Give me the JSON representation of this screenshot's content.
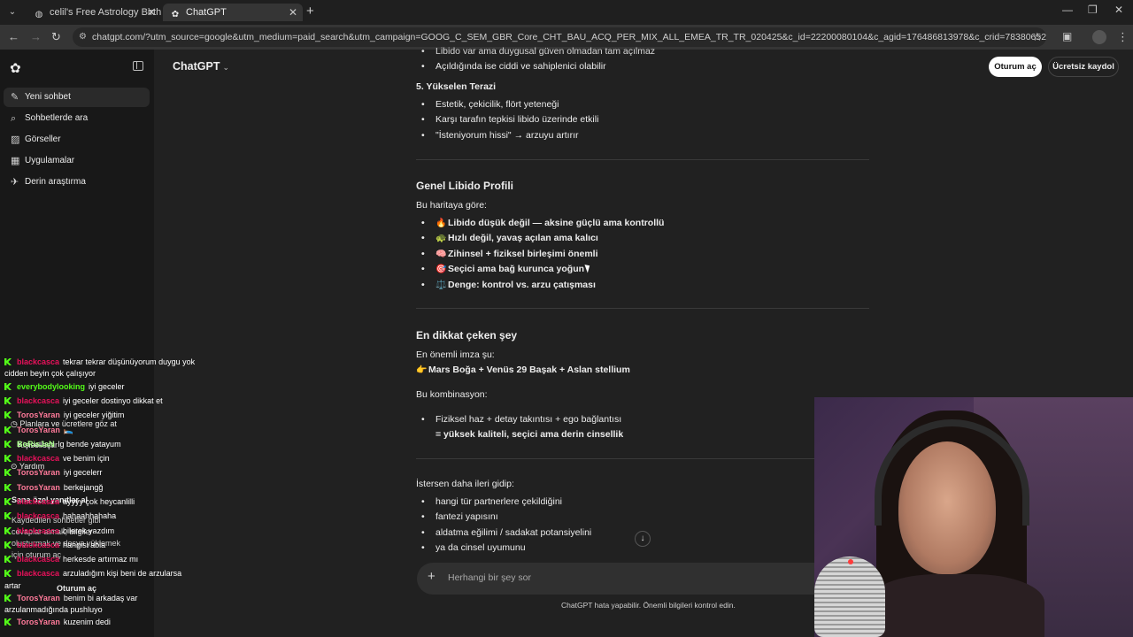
{
  "browser": {
    "tabs": [
      {
        "title": "celil's Free Astrology Birth Char",
        "favicon": "globe-icon"
      },
      {
        "title": "ChatGPT",
        "favicon": "chatgpt-icon"
      }
    ],
    "url": "chatgpt.com/?utm_source=google&utm_medium=paid_search&utm_campaign=GOOG_C_SEM_GBR_Core_CHT_BAU_ACQ_PER_MIX_ALL_EMEA_TR_TR_020425&c_id=22200080104&c_agid=176486813978&c_crid=783806529249&c_kwid=kwd-1927227100..."
  },
  "sidebar": {
    "items": [
      {
        "label": "Yeni sohbet",
        "icon": "new-chat-icon"
      },
      {
        "label": "Sohbetlerde ara",
        "icon": "search-icon"
      },
      {
        "label": "Görseller",
        "icon": "image-icon"
      },
      {
        "label": "Uygulamalar",
        "icon": "apps-icon"
      },
      {
        "label": "Derin araştırma",
        "icon": "telescope-icon"
      }
    ],
    "bottom": {
      "plans": "Planlara ve ücretlere göz at",
      "personalize": "Kişiselleştir",
      "help": "Yardım",
      "tailored": "Sana özel yanıtlar al",
      "save_line1": "Kaydedilen sohbetler gibi",
      "save_line2": "cevaplar almak, bilgiler",
      "save_line3": "oluşturmak ve dosya yüklemek",
      "save_line4": "için oturum aç",
      "login": "Oturum aç"
    }
  },
  "header": {
    "brand": "ChatGPT",
    "login": "Oturum aç",
    "signup": "Ücretsiz kaydol"
  },
  "content": {
    "top1": "Libido var ama duygusal güven olmadan tam açılmaz",
    "top2": "Açıldığında ise ciddi ve sahiplenici olabilir",
    "s5_title": "5. Yükselen Terazi",
    "s5_items": [
      "Estetik, çekicilik, flört yeteneği",
      "Karşı tarafın tepkisi libido üzerinde etkili",
      "\"İsteniyorum hissi\" → arzuyu artırır"
    ],
    "genel_title": "Genel Libido Profili",
    "genel_intro": "Bu haritaya göre:",
    "genel_items": [
      {
        "emoji": "🔥",
        "text": "Libido düşük değil — aksine güçlü ama kontrollü"
      },
      {
        "emoji": "🐢",
        "text": "Hızlı değil, yavaş açılan ama kalıcı"
      },
      {
        "emoji": "🧠",
        "text": "Zihinsel + fiziksel birleşimi önemli"
      },
      {
        "emoji": "🎯",
        "text": "Seçici ama bağ kurunca yoğun"
      },
      {
        "emoji": "⚖️",
        "text": "Denge: kontrol vs. arzu çatışması"
      }
    ],
    "dikkat_title": "En dikkat çeken şey",
    "imza_intro": "En önemli imza şu:",
    "imza_emoji": "👉",
    "imza_text": "Mars Boğa + Venüs 29 Başak + Aslan stellium",
    "komb_intro": "Bu kombinasyon:",
    "komb_line1": "Fiziksel haz + detay takıntısı + ego bağlantısı",
    "komb_line2": "= yüksek kaliteli, seçici ama derin cinsellik",
    "ileri_intro": "İstersen daha ileri gidip:",
    "ileri_items": [
      "hangi tür partnerlere çekildiğini",
      "fantezi yapısını",
      "aldatma eğilimi / sadakat potansiyelini",
      "ya da cinsel uyumunu"
    ]
  },
  "composer": {
    "placeholder": "Herhangi bir şey sor"
  },
  "disclaimer": "ChatGPT hata yapabilir. Önemli bilgileri kontrol edin.",
  "chat_overlay": {
    "messages": [
      {
        "user": "blackcasca",
        "color": "#e9115b",
        "text": "tekrar tekrar düşünüyorum duygu yok"
      },
      {
        "user": "everybodylooking",
        "color": "#53fc18",
        "text": "iyi geceler"
      },
      {
        "user": "blackcasca",
        "color": "#e9115b",
        "text": "iyi geceler dostinyo dikkat et"
      },
      {
        "user": "TorosYaran",
        "color": "#ff7a9a",
        "text": "iyi geceler yiğitim"
      },
      {
        "user": "TorosYaran",
        "color": "#ff7a9a",
        "text": "🛌"
      },
      {
        "user": "BoRisJaN",
        "color": "#a9ff8a",
        "text": "lg bende yatayum"
      },
      {
        "user": "blackcasca",
        "color": "#e9115b",
        "text": "ve benim için"
      },
      {
        "user": "TorosYaran",
        "color": "#ff7a9a",
        "text": "iyi gecelerr"
      },
      {
        "user": "TorosYaran",
        "color": "#ff7a9a",
        "text": "berkejangğ"
      },
      {
        "user": "blackcasca",
        "color": "#e9115b",
        "text": "ayyyy çok heycanlilli"
      },
      {
        "user": "blackcasca",
        "color": "#e9115b",
        "text": "hahaahhahaha"
      },
      {
        "user": "blackcasca",
        "color": "#e9115b",
        "text": "bilerek yazdım"
      },
      {
        "user": "blackcasca",
        "color": "#e9115b",
        "text": "hangisi abla"
      },
      {
        "user": "blackcasca",
        "color": "#e9115b",
        "text": "herkesde artırmaz mı"
      },
      {
        "user": "blackcasca",
        "color": "#e9115b",
        "text": "arzuladığım kişi beni de arzularsa"
      },
      {
        "user": "TorosYaran",
        "color": "#ff7a9a",
        "text": "benim bi arkadaş var"
      },
      {
        "user": "TorosYaran",
        "color": "#ff7a9a",
        "text": "kuzenim dedi"
      }
    ],
    "wrap1": "cidden beyin çok çalışıyor",
    "wrap2": "artar",
    "wrap3": "arzulanmadığında pushluyo"
  }
}
